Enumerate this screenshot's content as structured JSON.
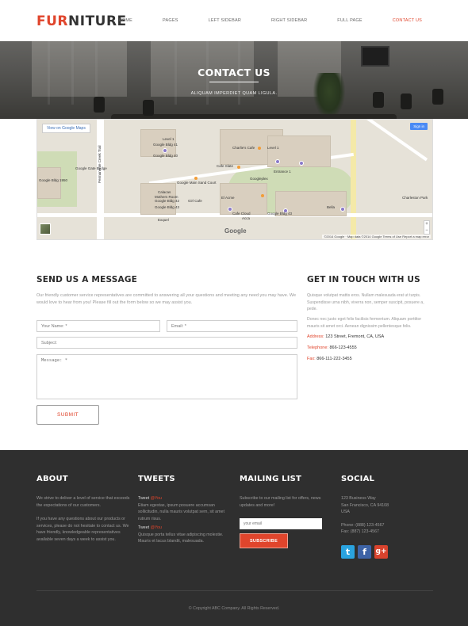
{
  "header": {
    "logo_accent": "FUR",
    "logo_rest": "NITURE",
    "nav": [
      "HOME",
      "PAGES",
      "LEFT SIDEBAR",
      "RIGHT SIDEBAR",
      "FULL PAGE",
      "CONTACT US"
    ],
    "active_nav": "CONTACT US",
    "accent_color": "#e0452c"
  },
  "hero": {
    "title": "CONTACT US",
    "subtitle": "ALIQUAM IMPERDIET QUAM LIGULA."
  },
  "map": {
    "view_link": "View on Google Maps",
    "sign_in": "Sign in",
    "brand": "Google",
    "zoom_in": "+",
    "zoom_out": "−",
    "attribution": "©2014 Google · Map data ©2014 Google   Terms of Use   Report a map error",
    "labels": [
      "Level 1",
      "Google Bldg 41",
      "Charlie's Cafe",
      "Level 1",
      "Google Bldg 40",
      "Google Gate Bridge",
      "Cafe Slate",
      "Google Main Sand Court",
      "Googleplex",
      "Entrance 1",
      "Google Bldg 42",
      "Girl Cafe",
      "Calacas",
      "Mothers Room",
      "Google Bldg 43",
      "Exquel",
      "El Acme",
      "Cafe Cloud",
      "Acca",
      "Google Bldg 43",
      "Charleston Park",
      "Google Bldg 1950",
      "Permanente Creek Trail",
      "Bella"
    ]
  },
  "message": {
    "title": "SEND US A MESSAGE",
    "intro": "Our friendly customer service representatives are committed to answering all your questions and meeting any need you may have. We would love to hear from you! Please fill out the form below so we may assist you.",
    "name_placeholder": "Your Name: *",
    "email_placeholder": "Email: *",
    "subject_placeholder": "Subject:",
    "message_placeholder": "Message: *",
    "submit_label": "SUBMIT"
  },
  "contact": {
    "title": "GET IN TOUCH WITH US",
    "p1": "Quisque volutpat mattis eros. Nullam malesuada erat ut turpis. Suspendisse urna nibh, viverra non, semper suscipit, posuere a, pede.",
    "p2": "Donec nec justo eget felis facilisis fermentum. Aliquam porttitor mauris sit amet orci. Aenean dignissim pellentesque felis.",
    "address_label": "Address:",
    "address": "123 Street, Fremont, CA, USA",
    "phone_label": "Telephone:",
    "phone": "866-123-4555",
    "fax_label": "Fax:",
    "fax": "866-111-222-3455"
  },
  "footer": {
    "about_title": "ABOUT",
    "about_p1": "We strive to deliver a level of service that exceeds the expectations of our customers.",
    "about_p2": "If you have any questions about our products or services, please do not hesitate to contact us. We have friendly, knowledgeable representatives available seven days a week to assist you.",
    "tweets_title": "TWEETS",
    "tweet_word": "Tweet",
    "tweet_handle": "@You",
    "tweet1": "Etiam egestas, ipsum posuere accumsan sollicitudin, nulla mauris volutpat sem, sit amet rutrum risus.",
    "tweet2": "Quisque porta tellus vitae adipiscing molestie. Mauris et lacus blandit, malesuada.",
    "mailing_title": "MAILING LIST",
    "mailing_text": "Subscribe to our mailing list for offers, news updates and more!",
    "email_placeholder": "your email",
    "subscribe_label": "SUBSCRIBE",
    "social_title": "SOCIAL",
    "social_addr1": "123 Business Way",
    "social_addr2": "San Francisco, CA 94108",
    "social_addr3": "USA",
    "social_phone": "Phone: (888) 123-4567",
    "social_fax": "Fax: (887) 123-4567",
    "twitter_glyph": "t",
    "facebook_glyph": "f",
    "gplus_glyph": "g+",
    "twitter_color": "#2aa3df",
    "facebook_color": "#3d63a6",
    "gplus_color": "#d8432e",
    "copyright": "© Copyright ABC Company. All Rights Reserved."
  }
}
